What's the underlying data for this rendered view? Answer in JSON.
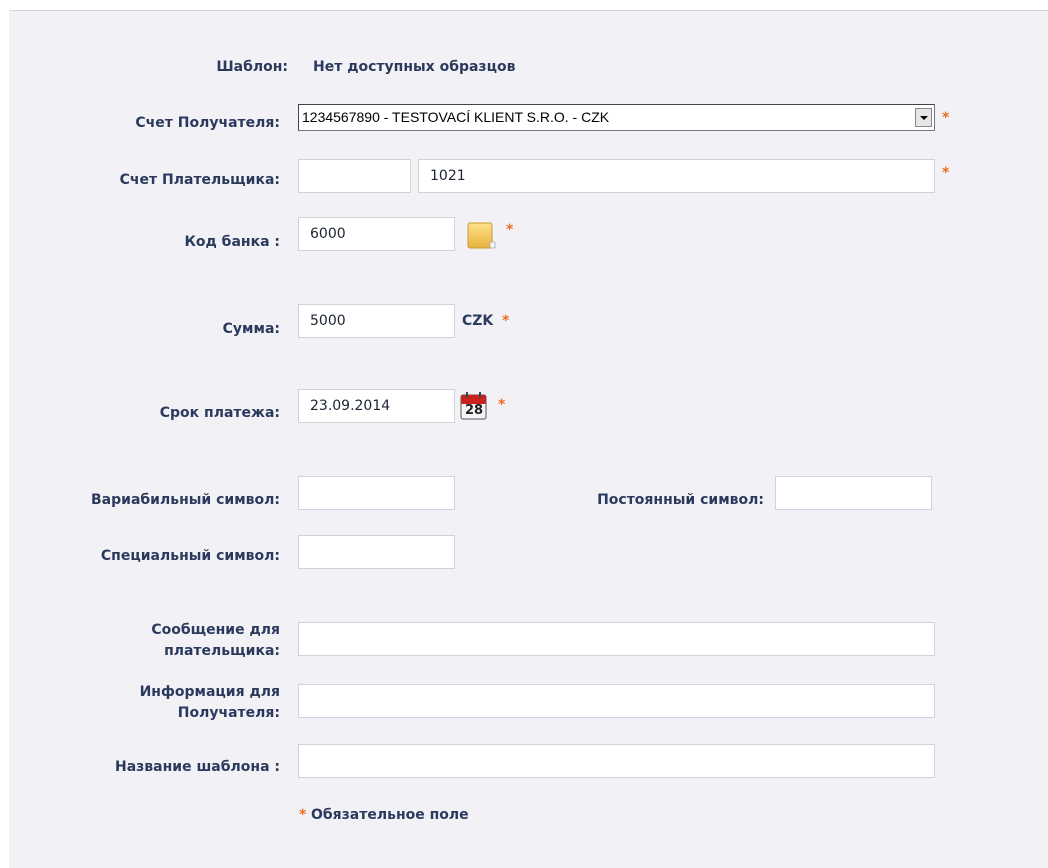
{
  "form": {
    "template_label": "Шаблон:",
    "template_value": "Нет доступных образцов",
    "recipient_account_label": "Счет Получателя:",
    "recipient_account_value": "1234567890 - TESTOVACÍ KLIENT S.R.O. - CZK",
    "payer_account_label": "Счет Плательщика:",
    "payer_account_prefix": "",
    "payer_account_number": "1021",
    "bank_code_label": "Код банка :",
    "bank_code_value": "6000",
    "amount_label": "Сумма:",
    "amount_value": "5000",
    "currency": "CZK",
    "due_date_label": "Срок платежа:",
    "due_date_value": "23.09.2014",
    "calendar_day": "28",
    "variable_symbol_label": "Вариабильный символ:",
    "variable_symbol_value": "",
    "constant_symbol_label": "Постоянный символ:",
    "constant_symbol_value": "",
    "specific_symbol_label": "Специальный символ:",
    "specific_symbol_value": "",
    "payer_message_label": "Сообщение для плательщика:",
    "payer_message_value": "",
    "recipient_info_label": "Информация для Получателя:",
    "recipient_info_value": "",
    "template_name_label": "Название шаблона :",
    "template_name_value": "",
    "required_marker": "*",
    "required_note": "Обязательное поле"
  },
  "colors": {
    "label": "#2b3a5c",
    "required": "#ef6a23",
    "background": "#f2f2f6",
    "input_border": "#cfd3dc"
  },
  "icons": {
    "bank_lookup": "folder-icon",
    "calendar": "calendar-icon",
    "select_arrow": "chevron-down-icon"
  }
}
